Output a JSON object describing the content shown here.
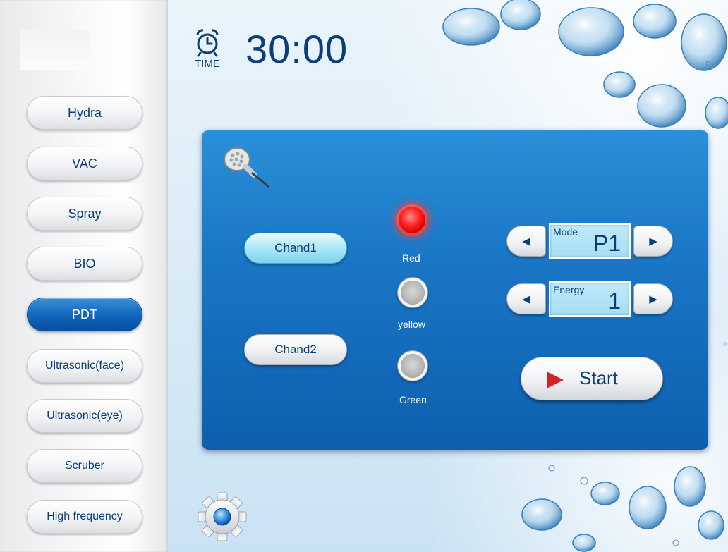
{
  "sidebar": {
    "items": [
      {
        "label": "Hydra",
        "active": false
      },
      {
        "label": "VAC",
        "active": false
      },
      {
        "label": "Spray",
        "active": false
      },
      {
        "label": "BIO",
        "active": false
      },
      {
        "label": "PDT",
        "active": true
      },
      {
        "label": "Ultrasonic(face)",
        "active": false
      },
      {
        "label": "Ultrasonic(eye)",
        "active": false
      },
      {
        "label": "Scruber",
        "active": false
      },
      {
        "label": "High frequency",
        "active": false
      }
    ]
  },
  "timer": {
    "label": "TIME",
    "value": "30:00",
    "icon": "alarm-clock-icon"
  },
  "panel": {
    "handpiece_icon": "led-handpiece-icon",
    "channels": {
      "chand1": {
        "label": "Chand1",
        "selected": true
      },
      "chand2": {
        "label": "Chand2",
        "selected": false
      }
    },
    "lights": [
      {
        "label": "Red",
        "on": true,
        "color": "#ff1f1f"
      },
      {
        "label": "yellow",
        "on": false
      },
      {
        "label": "Green",
        "on": false
      }
    ],
    "mode": {
      "caption": "Mode",
      "value": "P1"
    },
    "energy": {
      "caption": "Energy",
      "value": "1"
    },
    "start": {
      "label": "Start"
    }
  },
  "colors": {
    "accent": "#0b3e78",
    "active_nav": "#1064bb",
    "panel": "#1a77c6",
    "start_triangle": "#d2232a"
  },
  "settings": {
    "icon": "gear-icon"
  }
}
